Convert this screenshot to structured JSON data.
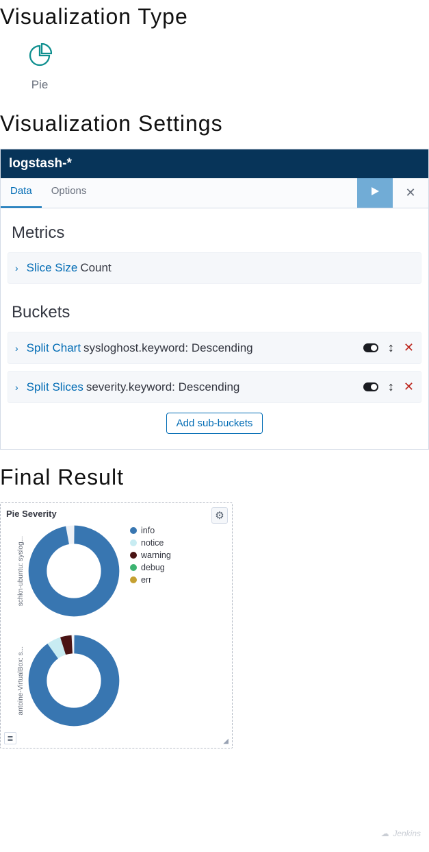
{
  "headings": {
    "vis_type": "Visualization Type",
    "vis_settings": "Visualization Settings",
    "final_result": "Final Result"
  },
  "vis_type": {
    "name": "Pie"
  },
  "settings": {
    "index_pattern": "logstash-*",
    "tabs": {
      "data": "Data",
      "options": "Options"
    },
    "metrics_title": "Metrics",
    "buckets_title": "Buckets",
    "metric": {
      "label": "Slice Size",
      "desc": "Count"
    },
    "buckets": [
      {
        "label": "Split Chart",
        "desc": "sysloghost.keyword: Descending"
      },
      {
        "label": "Split Slices",
        "desc": "severity.keyword: Descending"
      }
    ],
    "add_btn": "Add sub-buckets"
  },
  "result": {
    "title": "Pie Severity",
    "legend": [
      {
        "name": "info",
        "color": "#3876b1"
      },
      {
        "name": "notice",
        "color": "#c8ecf2"
      },
      {
        "name": "warning",
        "color": "#4a1414"
      },
      {
        "name": "debug",
        "color": "#3cb371"
      },
      {
        "name": "err",
        "color": "#c5a031"
      }
    ],
    "rows": [
      {
        "label": "schkn-ubuntu: syslog..."
      },
      {
        "label": "antoine-VirtualBox: s..."
      }
    ]
  },
  "watermark": "Jenkins",
  "chart_data": [
    {
      "type": "pie",
      "title": "Pie Severity — schkn-ubuntu",
      "series": [
        {
          "name": "info",
          "value": 97
        },
        {
          "name": "notice",
          "value": 1
        },
        {
          "name": "warning",
          "value": 1
        },
        {
          "name": "debug",
          "value": 0.5
        },
        {
          "name": "err",
          "value": 0.5
        }
      ]
    },
    {
      "type": "pie",
      "title": "Pie Severity — antoine-VirtualBox",
      "series": [
        {
          "name": "info",
          "value": 90
        },
        {
          "name": "notice",
          "value": 5
        },
        {
          "name": "warning",
          "value": 4
        },
        {
          "name": "debug",
          "value": 0.5
        },
        {
          "name": "err",
          "value": 0.5
        }
      ]
    }
  ]
}
